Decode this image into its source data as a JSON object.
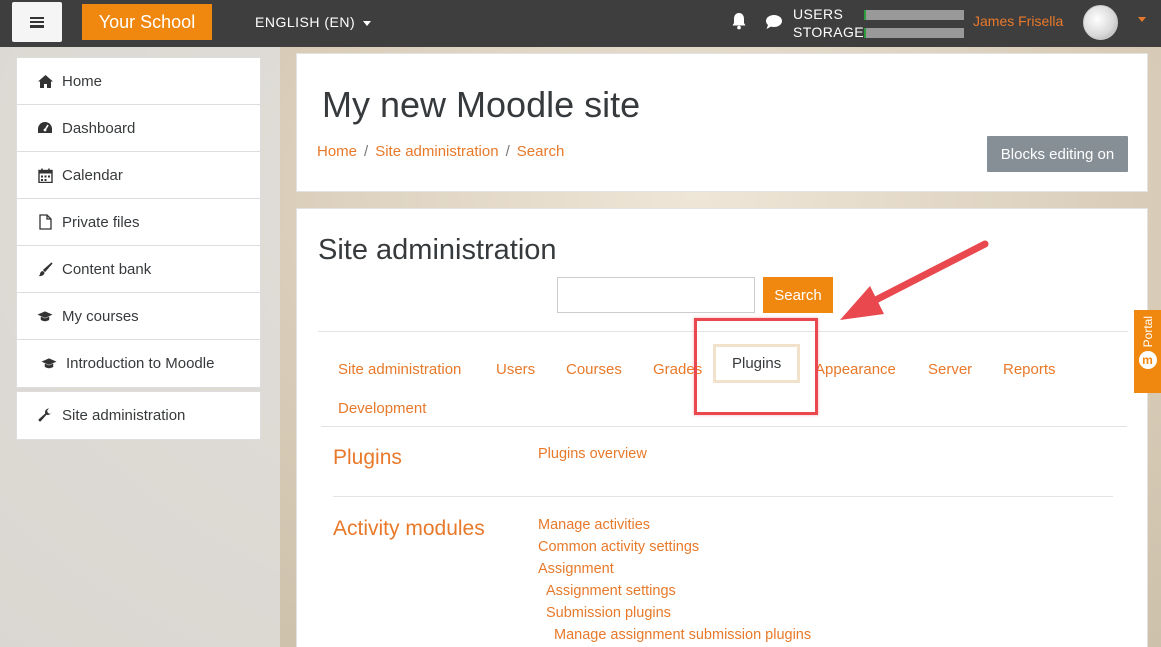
{
  "navbar": {
    "brand": "Your School",
    "language": "ENGLISH (EN)",
    "usage_users_label": "USERS",
    "usage_storage_label": "STORAGE",
    "usage_users_fraction": 0.02,
    "usage_storage_fraction": 0.02,
    "user_name": "James Frisella"
  },
  "drawer": {
    "items": [
      {
        "label": "Home",
        "icon": "home-icon"
      },
      {
        "label": "Dashboard",
        "icon": "dashboard-icon"
      },
      {
        "label": "Calendar",
        "icon": "calendar-icon"
      },
      {
        "label": "Private files",
        "icon": "file-icon"
      },
      {
        "label": "Content bank",
        "icon": "paintbrush-icon"
      },
      {
        "label": "My courses",
        "icon": "graduation-cap-icon"
      },
      {
        "label": "Introduction to Moodle",
        "icon": "graduation-cap-icon"
      }
    ],
    "admin_item": {
      "label": "Site administration",
      "icon": "wrench-icon"
    }
  },
  "header": {
    "site_title": "My new Moodle site",
    "breadcrumb": [
      "Home",
      "Site administration",
      "Search"
    ],
    "editing_button": "Blocks editing on"
  },
  "admin": {
    "title": "Site administration",
    "search_button": "Search",
    "search_value": "",
    "tabs": [
      "Site administration",
      "Users",
      "Courses",
      "Grades",
      "Plugins",
      "Appearance",
      "Server",
      "Reports",
      "Development"
    ],
    "active_tab": "Plugins",
    "sections": [
      {
        "title": "Plugins",
        "links": [
          "Plugins overview"
        ]
      },
      {
        "title": "Activity modules",
        "links": [
          "Manage activities",
          "Common activity settings",
          "Assignment",
          "Assignment settings",
          "Submission plugins",
          "Manage assignment submission plugins"
        ]
      }
    ]
  },
  "portal": {
    "label": "Portal"
  },
  "colors": {
    "accent": "#f0880f",
    "link": "#e8792a",
    "navbar": "#3e3e3e",
    "annotation": "#e8484e"
  }
}
